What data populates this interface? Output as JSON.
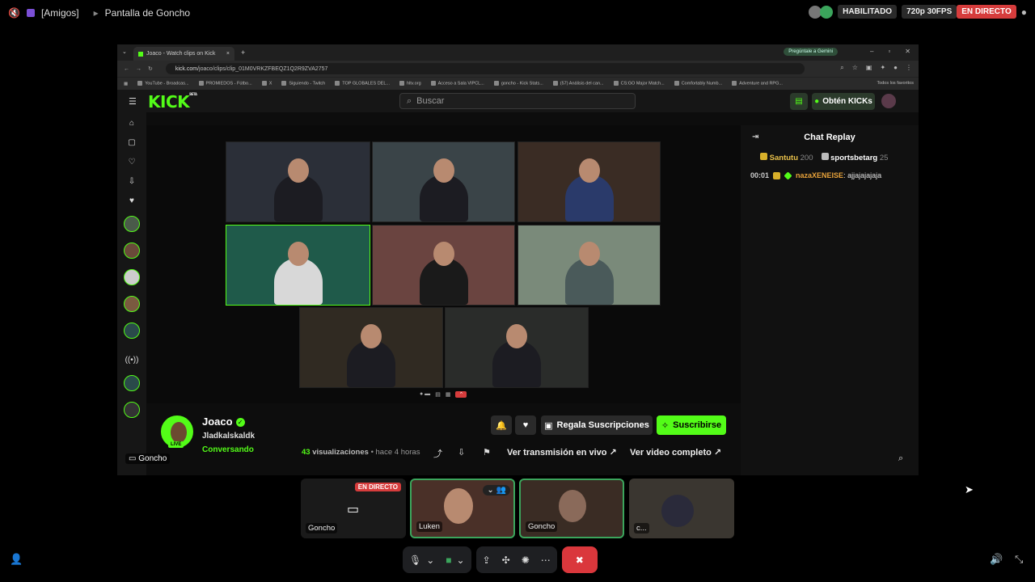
{
  "discord": {
    "server_name": "[Amigos]",
    "window_title": "Pantalla de Goncho",
    "status_habilitado": "HABILITADO",
    "quality": "720p 30FPS",
    "live": "EN DIRECTO",
    "screen_owner_label": "Goncho",
    "tiles": [
      {
        "label": "Goncho",
        "badge": "EN DIRECTO"
      },
      {
        "label": "Luken"
      },
      {
        "label": "Goncho"
      },
      {
        "label": "c..."
      }
    ]
  },
  "browser": {
    "tab_title": "Joaco - Watch clips on Kick",
    "gemini": "Pregúntale a Gemini",
    "url_host": "kick.com",
    "url_path": "/joaco/clips/clip_01M0VRKZFBEQZ1Q2R9ZVA2757",
    "bookmarks": [
      "YouTube - Broadcas...",
      "PROMIEDOS - Fútbo...",
      "X",
      "Siguiendo - Twitch",
      "TOP GLOBALES DEL...",
      "hltv.org",
      "Acceso a Sala VIPCL...",
      "goncho - Kick Stats...",
      "(57) Análisis del can...",
      "CS:GO Major Match...",
      "Comfortably Numb...",
      "Adventure and RPG..."
    ],
    "all_favorites": "Todos los favoritos"
  },
  "kick": {
    "logo": "KICK",
    "logo_beta": "BETA",
    "search_placeholder": "Buscar",
    "get_kicks": "Obtén KICKs",
    "chat": {
      "title": "Chat Replay",
      "gifters": [
        {
          "name": "Santutu",
          "count": "200"
        },
        {
          "name": "sportsbetarg",
          "count": "25"
        }
      ],
      "messages": [
        {
          "time": "00:01",
          "user": "nazaXENEISE",
          "text": "ajjajajajaja"
        }
      ]
    },
    "channel": {
      "name": "Joaco",
      "live_badge": "LIVE",
      "stream_title": "Jladkalskaldk",
      "category": "Conversando",
      "views_count": "43",
      "views_label": "visualizaciones",
      "time_ago": "• hace 4 horas",
      "gift_subs": "Regala Suscripciones",
      "subscribe": "Suscribirse",
      "watch_live": "Ver transmisión en vivo",
      "full_video": "Ver video completo"
    }
  }
}
